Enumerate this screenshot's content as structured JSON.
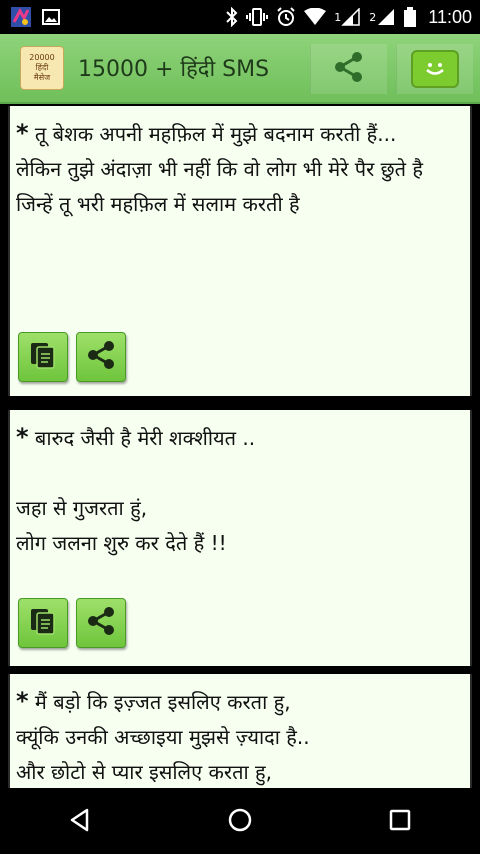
{
  "status_bar": {
    "time": "11:00",
    "sim1_label": "1",
    "sim2_label": "2",
    "icons": [
      "app-notification-icon",
      "image-notification-icon",
      "bluetooth-icon",
      "vibrate-icon",
      "alarm-icon",
      "wifi-icon",
      "signal-sim1-icon",
      "signal-sim2-icon",
      "battery-icon"
    ]
  },
  "app_bar": {
    "logo_line1": "20000",
    "logo_line2": "हिंदी",
    "logo_line3": "मैसेज",
    "title": "15000 + हिंदी SMS",
    "share_icon": "share-icon",
    "chat_icon": "smiley-chat-icon",
    "accent_color": "#7cc86a"
  },
  "messages": [
    {
      "star": "*",
      "text": " तू बेशक अपनी महफ़िल में मुझे बदनाम करती हैं...\nलेकिन तुझे अंदाज़ा भी नहीं कि वो लोग भी मेरे पैर छुते है\nजिन्हें तू भरी महफ़िल में सलाम करती है"
    },
    {
      "star": "*",
      "text": " बारुद जैसी है मेरी शक्शीयत ..\n\nजहा से गुजरता हुं,\nलोग जलना शुरु कर देते हैं !!"
    },
    {
      "star": "*",
      "text": " मैं बड़ो कि इज़्जत इसलिए करता हु,\nक्यूंकि उनकी अच्छाइया मुझसे ज़्यादा है..\nऔर छोटो से प्यार इसलिए करता हु,"
    }
  ],
  "actions": {
    "copy_icon": "copy-icon",
    "share_icon": "share-icon"
  },
  "nav_bar": {
    "back_icon": "back-icon",
    "home_icon": "home-icon",
    "recents_icon": "recents-icon"
  }
}
